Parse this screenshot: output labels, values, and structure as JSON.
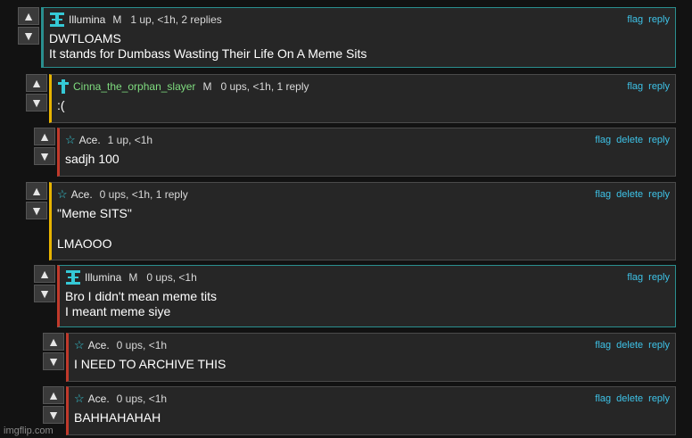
{
  "comments": [
    {
      "user": "Illumina",
      "mod": "M",
      "meta": "1 up, <1h, 2 replies",
      "badge": "illumina-badge-icon",
      "actions": [
        "flag",
        "reply"
      ],
      "lines": [
        "DWTLOAMS",
        "It stands for Dumbass Wasting Their Life On A Meme Sits"
      ]
    },
    {
      "user": "Cinna_the_orphan_slayer",
      "mod": "M",
      "meta": "0 ups, <1h, 1 reply",
      "badge": "cross-icon",
      "actions": [
        "flag",
        "reply"
      ],
      "lines": [
        ":("
      ]
    },
    {
      "user": "Ace.",
      "meta": "1 up, <1h",
      "badge": "star-icon",
      "actions": [
        "flag",
        "delete",
        "reply"
      ],
      "lines": [
        "sadjh 100"
      ]
    },
    {
      "user": "Ace.",
      "meta": "0 ups, <1h, 1 reply",
      "badge": "star-icon",
      "actions": [
        "flag",
        "delete",
        "reply"
      ],
      "lines": [
        "\"Meme SITS\"",
        "",
        "LMAOOO"
      ]
    },
    {
      "user": "Illumina",
      "mod": "M",
      "meta": "0 ups, <1h",
      "badge": "illumina-badge-icon",
      "actions": [
        "flag",
        "reply"
      ],
      "lines": [
        "Bro I didn't mean meme tits",
        "I meant meme siye"
      ]
    },
    {
      "user": "Ace.",
      "meta": "0 ups, <1h",
      "badge": "star-icon",
      "actions": [
        "flag",
        "delete",
        "reply"
      ],
      "lines": [
        "I NEED TO ARCHIVE THIS"
      ]
    },
    {
      "user": "Ace.",
      "meta": "0 ups, <1h",
      "badge": "star-icon",
      "actions": [
        "flag",
        "delete",
        "reply"
      ],
      "lines": [
        "BAHHAHAHAH"
      ]
    }
  ],
  "colors": {
    "link": "#3ec3e8",
    "teal": "#2a8f8f",
    "yellow": "#e8b400",
    "blue": "#3a7bd5",
    "red": "#c0392b"
  },
  "icons": {
    "upvote": "up-arrow-icon",
    "downvote": "down-arrow-icon"
  },
  "watermark": "imgflip.com"
}
